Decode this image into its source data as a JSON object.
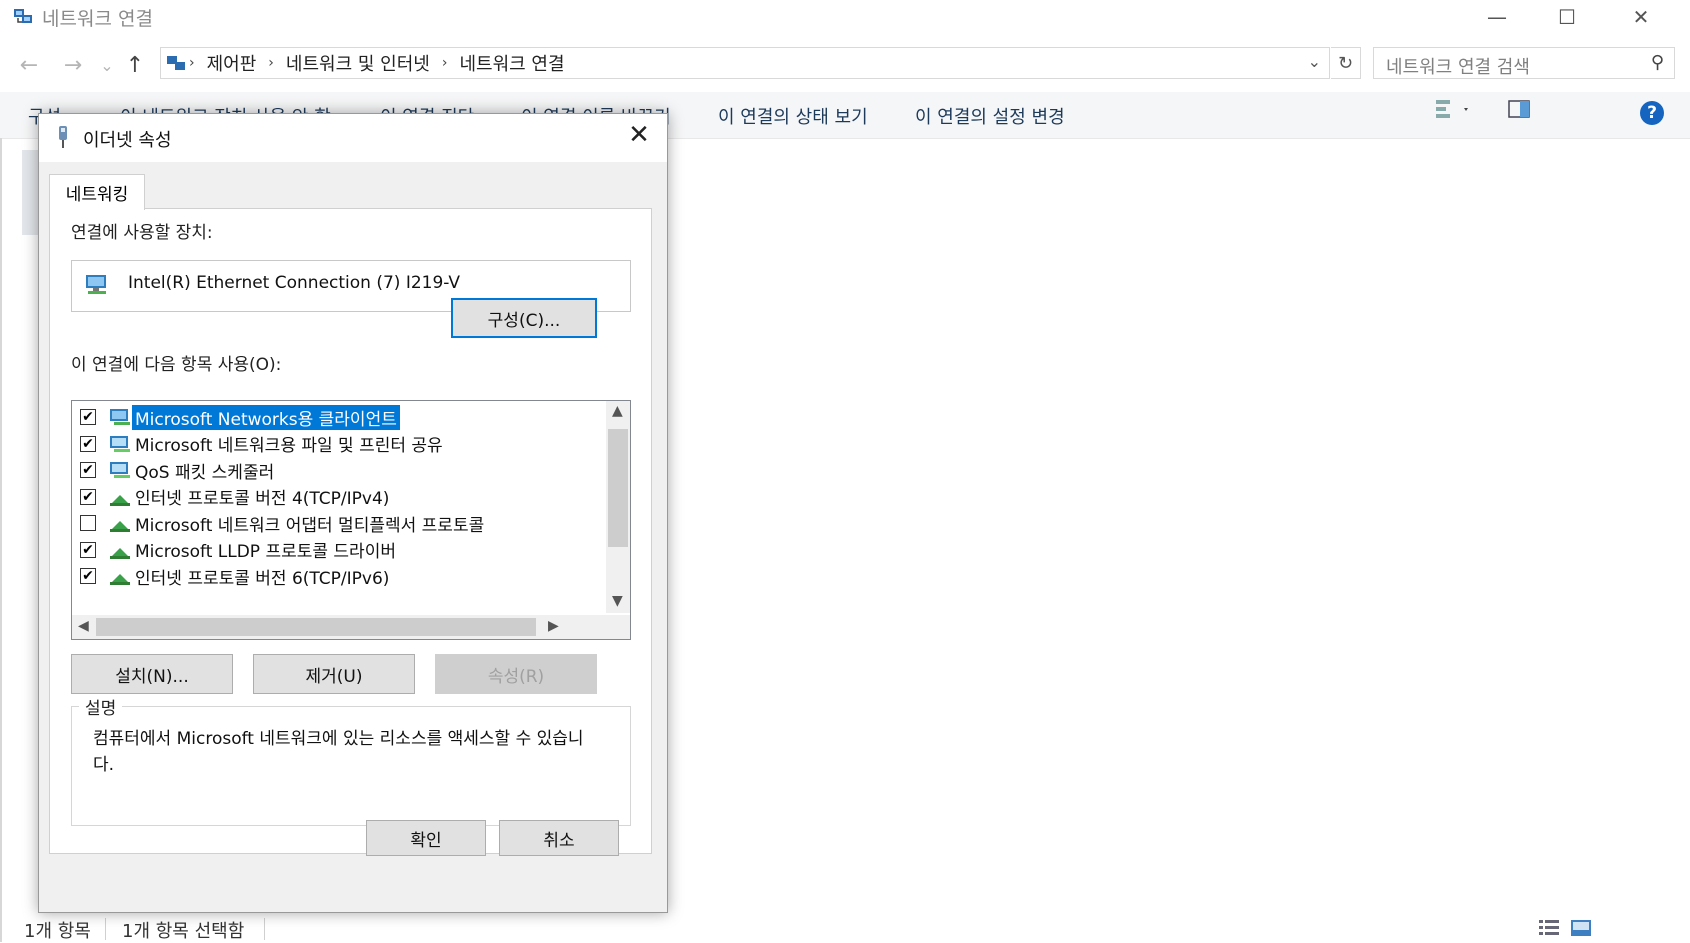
{
  "window": {
    "title": "네트워크 연결",
    "minimize": "—",
    "maximize": "☐",
    "close": "✕"
  },
  "nav": {
    "back": "←",
    "forward": "→",
    "recent": "⌄",
    "up": "↑",
    "breadcrumb": [
      "제어판",
      "네트워크 및 인터넷",
      "네트워크 연결"
    ],
    "search_placeholder": "네트워크 연결 검색"
  },
  "commands": [
    "구성 ▾",
    "이 네트워크 장치 사용 안 함",
    "이 연결 진단",
    "이 연결 이름 바꾸기",
    "이 연결의 상태 보기",
    "이 연결의 설정 변경"
  ],
  "status_bar": {
    "item_count": "1개 항목",
    "selected": "1개 항목 선택함"
  },
  "dialog": {
    "title": "이더넷 속성",
    "tab": "네트워킹",
    "device_label": "연결에 사용할 장치:",
    "device_name": "Intel(R) Ethernet Connection (7) I219-V",
    "configure_button": "구성(C)...",
    "items_label": "이 연결에 다음 항목 사용(O):",
    "items": [
      {
        "label": "Microsoft Networks용 클라이언트",
        "checked": true,
        "selected": true,
        "icon": "network-client-icon"
      },
      {
        "label": "Microsoft 네트워크용 파일 및 프린터 공유",
        "checked": true,
        "selected": false,
        "icon": "network-service-icon"
      },
      {
        "label": "QoS 패킷 스케줄러",
        "checked": true,
        "selected": false,
        "icon": "network-service-icon"
      },
      {
        "label": "인터넷 프로토콜 버전 4(TCP/IPv4)",
        "checked": true,
        "selected": false,
        "icon": "protocol-icon"
      },
      {
        "label": "Microsoft 네트워크 어댑터 멀티플렉서 프로토콜",
        "checked": false,
        "selected": false,
        "icon": "protocol-icon"
      },
      {
        "label": "Microsoft LLDP 프로토콜 드라이버",
        "checked": true,
        "selected": false,
        "icon": "protocol-icon"
      },
      {
        "label": "인터넷 프로토콜 버전 6(TCP/IPv6)",
        "checked": true,
        "selected": false,
        "icon": "protocol-icon"
      }
    ],
    "install_button": "설치(N)...",
    "uninstall_button": "제거(U)",
    "properties_button": "속성(R)",
    "description_label": "설명",
    "description_text": "컴퓨터에서 Microsoft 네트워크에 있는 리소스를 액세스할 수 있습니다.",
    "ok_button": "확인",
    "cancel_button": "취소"
  },
  "colors": {
    "accent": "#0078d7",
    "help": "#1565c0",
    "command_text": "#1e3a5a"
  }
}
